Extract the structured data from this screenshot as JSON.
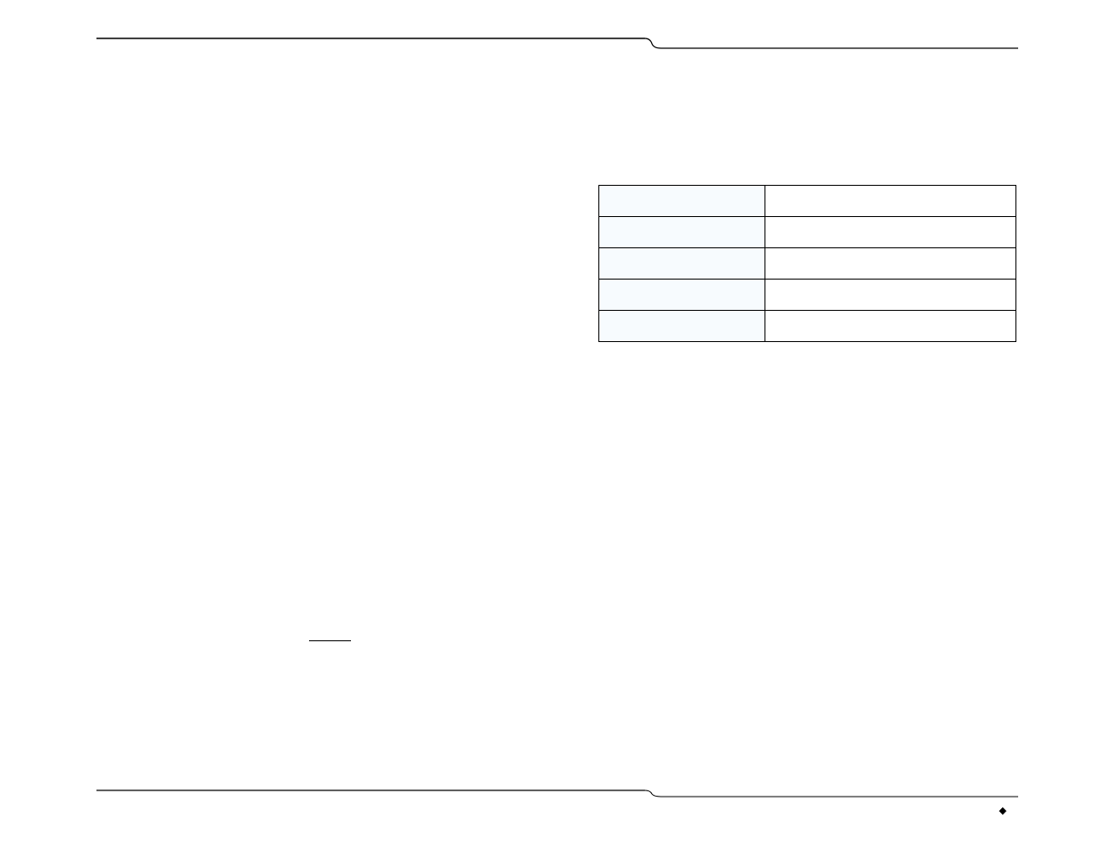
{
  "rules": {
    "notch_offset_ratio": 0.6
  },
  "table": {
    "rows": [
      {
        "key": "",
        "value": ""
      },
      {
        "key": "",
        "value": ""
      },
      {
        "key": "",
        "value": ""
      },
      {
        "key": "",
        "value": ""
      },
      {
        "key": "",
        "value": ""
      }
    ]
  },
  "faint_left": {
    "visible_fragment": ""
  },
  "faint_right_below_table": {
    "link_like_fragment": ""
  },
  "footer": {
    "diamond": "◆",
    "page_like": ""
  }
}
